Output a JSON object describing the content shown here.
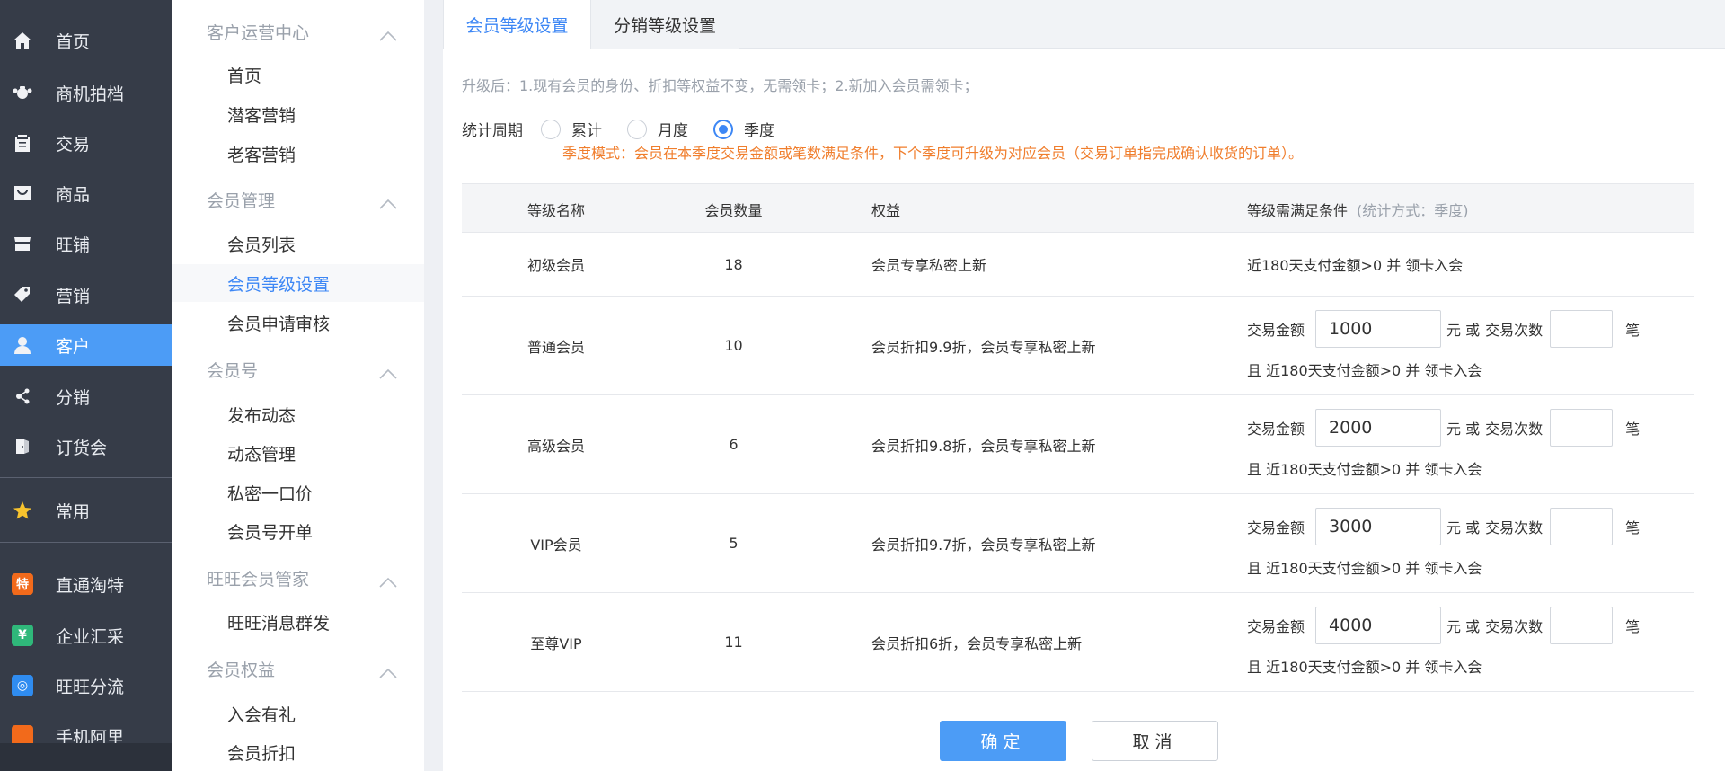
{
  "colors": {
    "sidebar_bg": "#363c48",
    "accent": "#4c9cf6",
    "link": "#3d87f5",
    "hint_orange": "#f07e2d",
    "muted": "#9aa1ab"
  },
  "nav1": {
    "items": [
      {
        "label": "首页",
        "icon": "home-icon"
      },
      {
        "label": "商机拍档",
        "icon": "handshake-icon"
      },
      {
        "label": "交易",
        "icon": "clipboard-icon"
      },
      {
        "label": "商品",
        "icon": "bag-icon"
      },
      {
        "label": "旺铺",
        "icon": "store-icon"
      },
      {
        "label": "营销",
        "icon": "tag-icon"
      },
      {
        "label": "客户",
        "icon": "user-icon",
        "active": true
      },
      {
        "label": "分销",
        "icon": "share-icon"
      },
      {
        "label": "订货会",
        "icon": "door-icon"
      },
      {
        "label": "常用",
        "icon": "star-icon"
      },
      {
        "label": "直通淘特",
        "icon": "te-badge-icon",
        "badge_text": "特",
        "badge_color": "#f26a1b"
      },
      {
        "label": "企业汇采",
        "icon": "enterprise-badge-icon",
        "badge_text": "¥",
        "badge_color": "#2fb87a"
      },
      {
        "label": "旺旺分流",
        "icon": "wangwang-badge-icon",
        "badge_text": "◎",
        "badge_color": "#2f8cf0"
      },
      {
        "label": "手机阿里",
        "icon": "mobile-badge-icon",
        "badge_text": "",
        "badge_color": "#f26a1b"
      }
    ]
  },
  "nav2": {
    "groups": [
      {
        "title": "客户运营中心",
        "items": [
          "首页",
          "潜客营销",
          "老客营销"
        ]
      },
      {
        "title": "会员管理",
        "items": [
          "会员列表",
          "会员等级设置",
          "会员申请审核"
        ]
      },
      {
        "title": "会员号",
        "items": [
          "发布动态",
          "动态管理",
          "私密一口价",
          "会员号开单"
        ]
      },
      {
        "title": "旺旺会员管家",
        "items": [
          "旺旺消息群发"
        ]
      },
      {
        "title": "会员权益",
        "items": [
          "入会有礼",
          "会员折扣"
        ]
      }
    ],
    "active_item": "会员等级设置"
  },
  "tabs": [
    {
      "label": "会员等级设置",
      "active": true
    },
    {
      "label": "分销等级设置",
      "active": false
    }
  ],
  "notice": "升级后：1.现有会员的身份、折扣等权益不变，无需领卡；2.新加入会员需领卡；",
  "period": {
    "label": "统计周期",
    "options": [
      {
        "label": "累计",
        "checked": false
      },
      {
        "label": "月度",
        "checked": false
      },
      {
        "label": "季度",
        "checked": true
      }
    ],
    "hint": "季度模式：会员在本季度交易金额或笔数满足条件，下个季度可升级为对应会员（交易订单指完成确认收货的订单）。"
  },
  "table": {
    "headers": {
      "name": "等级名称",
      "count": "会员数量",
      "benefit": "权益",
      "condition": "等级需满足条件",
      "condition_sub": "(统计方式：季度)"
    },
    "condition_texts": {
      "amount_label": "交易金额",
      "unit_or": "元 或",
      "count_label": "交易次数",
      "count_unit": "笔",
      "second_line": "且 近180天支付金额>0 并 领卡入会"
    },
    "rows": [
      {
        "name": "初级会员",
        "count": "18",
        "benefit": "会员专享私密上新",
        "plain_condition": "近180天支付金额>0 并 领卡入会"
      },
      {
        "name": "普通会员",
        "count": "10",
        "benefit": "会员折扣9.9折，会员专享私密上新",
        "amount": "1000",
        "times": ""
      },
      {
        "name": "高级会员",
        "count": "6",
        "benefit": "会员折扣9.8折，会员专享私密上新",
        "amount": "2000",
        "times": ""
      },
      {
        "name": "VIP会员",
        "count": "5",
        "benefit": "会员折扣9.7折，会员专享私密上新",
        "amount": "3000",
        "times": ""
      },
      {
        "name": "至尊VIP",
        "count": "11",
        "benefit": "会员折扣6折，会员专享私密上新",
        "amount": "4000",
        "times": ""
      }
    ]
  },
  "buttons": {
    "confirm": "确定",
    "cancel": "取消"
  }
}
